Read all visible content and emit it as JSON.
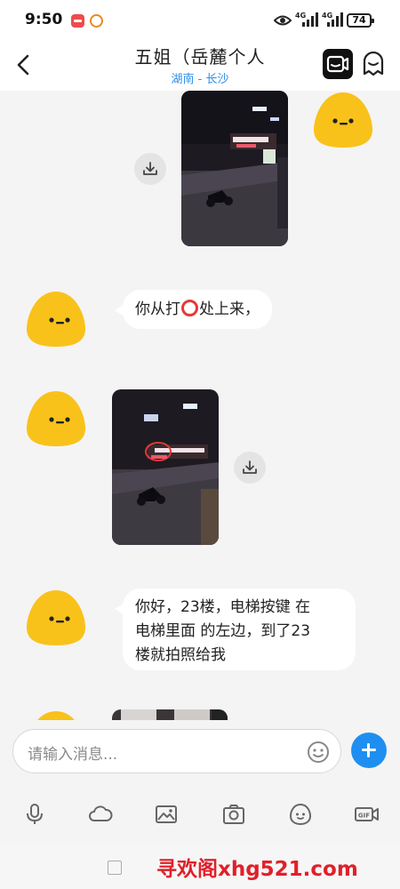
{
  "status_bar": {
    "time": "9:50",
    "network_1": "4G",
    "network_2": "4G",
    "battery": "74"
  },
  "header": {
    "title": "五姐（岳麓个人",
    "subtitle": "湖南 - 长沙"
  },
  "messages": [
    {
      "type": "image",
      "side": "right",
      "scene": "night-street-scooter"
    },
    {
      "type": "text",
      "side": "left",
      "text_before": "你从打",
      "emoji": "red-ring",
      "text_after": "处上来，"
    },
    {
      "type": "image",
      "side": "left",
      "scene": "night-street-scooter-circled"
    },
    {
      "type": "text",
      "side": "left",
      "lines": [
        "你好，23楼，电梯按键 在",
        "电梯里面 的左边，到了23",
        "楼就拍照给我"
      ]
    },
    {
      "type": "image",
      "side": "left",
      "scene": "partial-next-image"
    }
  ],
  "composer": {
    "placeholder": "请输入消息..."
  },
  "toolbar": {
    "items": [
      "microphone-icon",
      "cloud-icon",
      "image-icon",
      "camera-icon",
      "sticker-icon",
      "gif-icon"
    ],
    "gif_label": "GIF"
  },
  "nav": {
    "watermark": "寻欢阁xhg521.com"
  },
  "colors": {
    "accent_blue": "#1e8ff0",
    "subtitle_blue": "#2e8ee8",
    "avatar_yellow": "#f9c21a",
    "watermark_red": "#e0202a",
    "background": "#f4f4f4"
  }
}
